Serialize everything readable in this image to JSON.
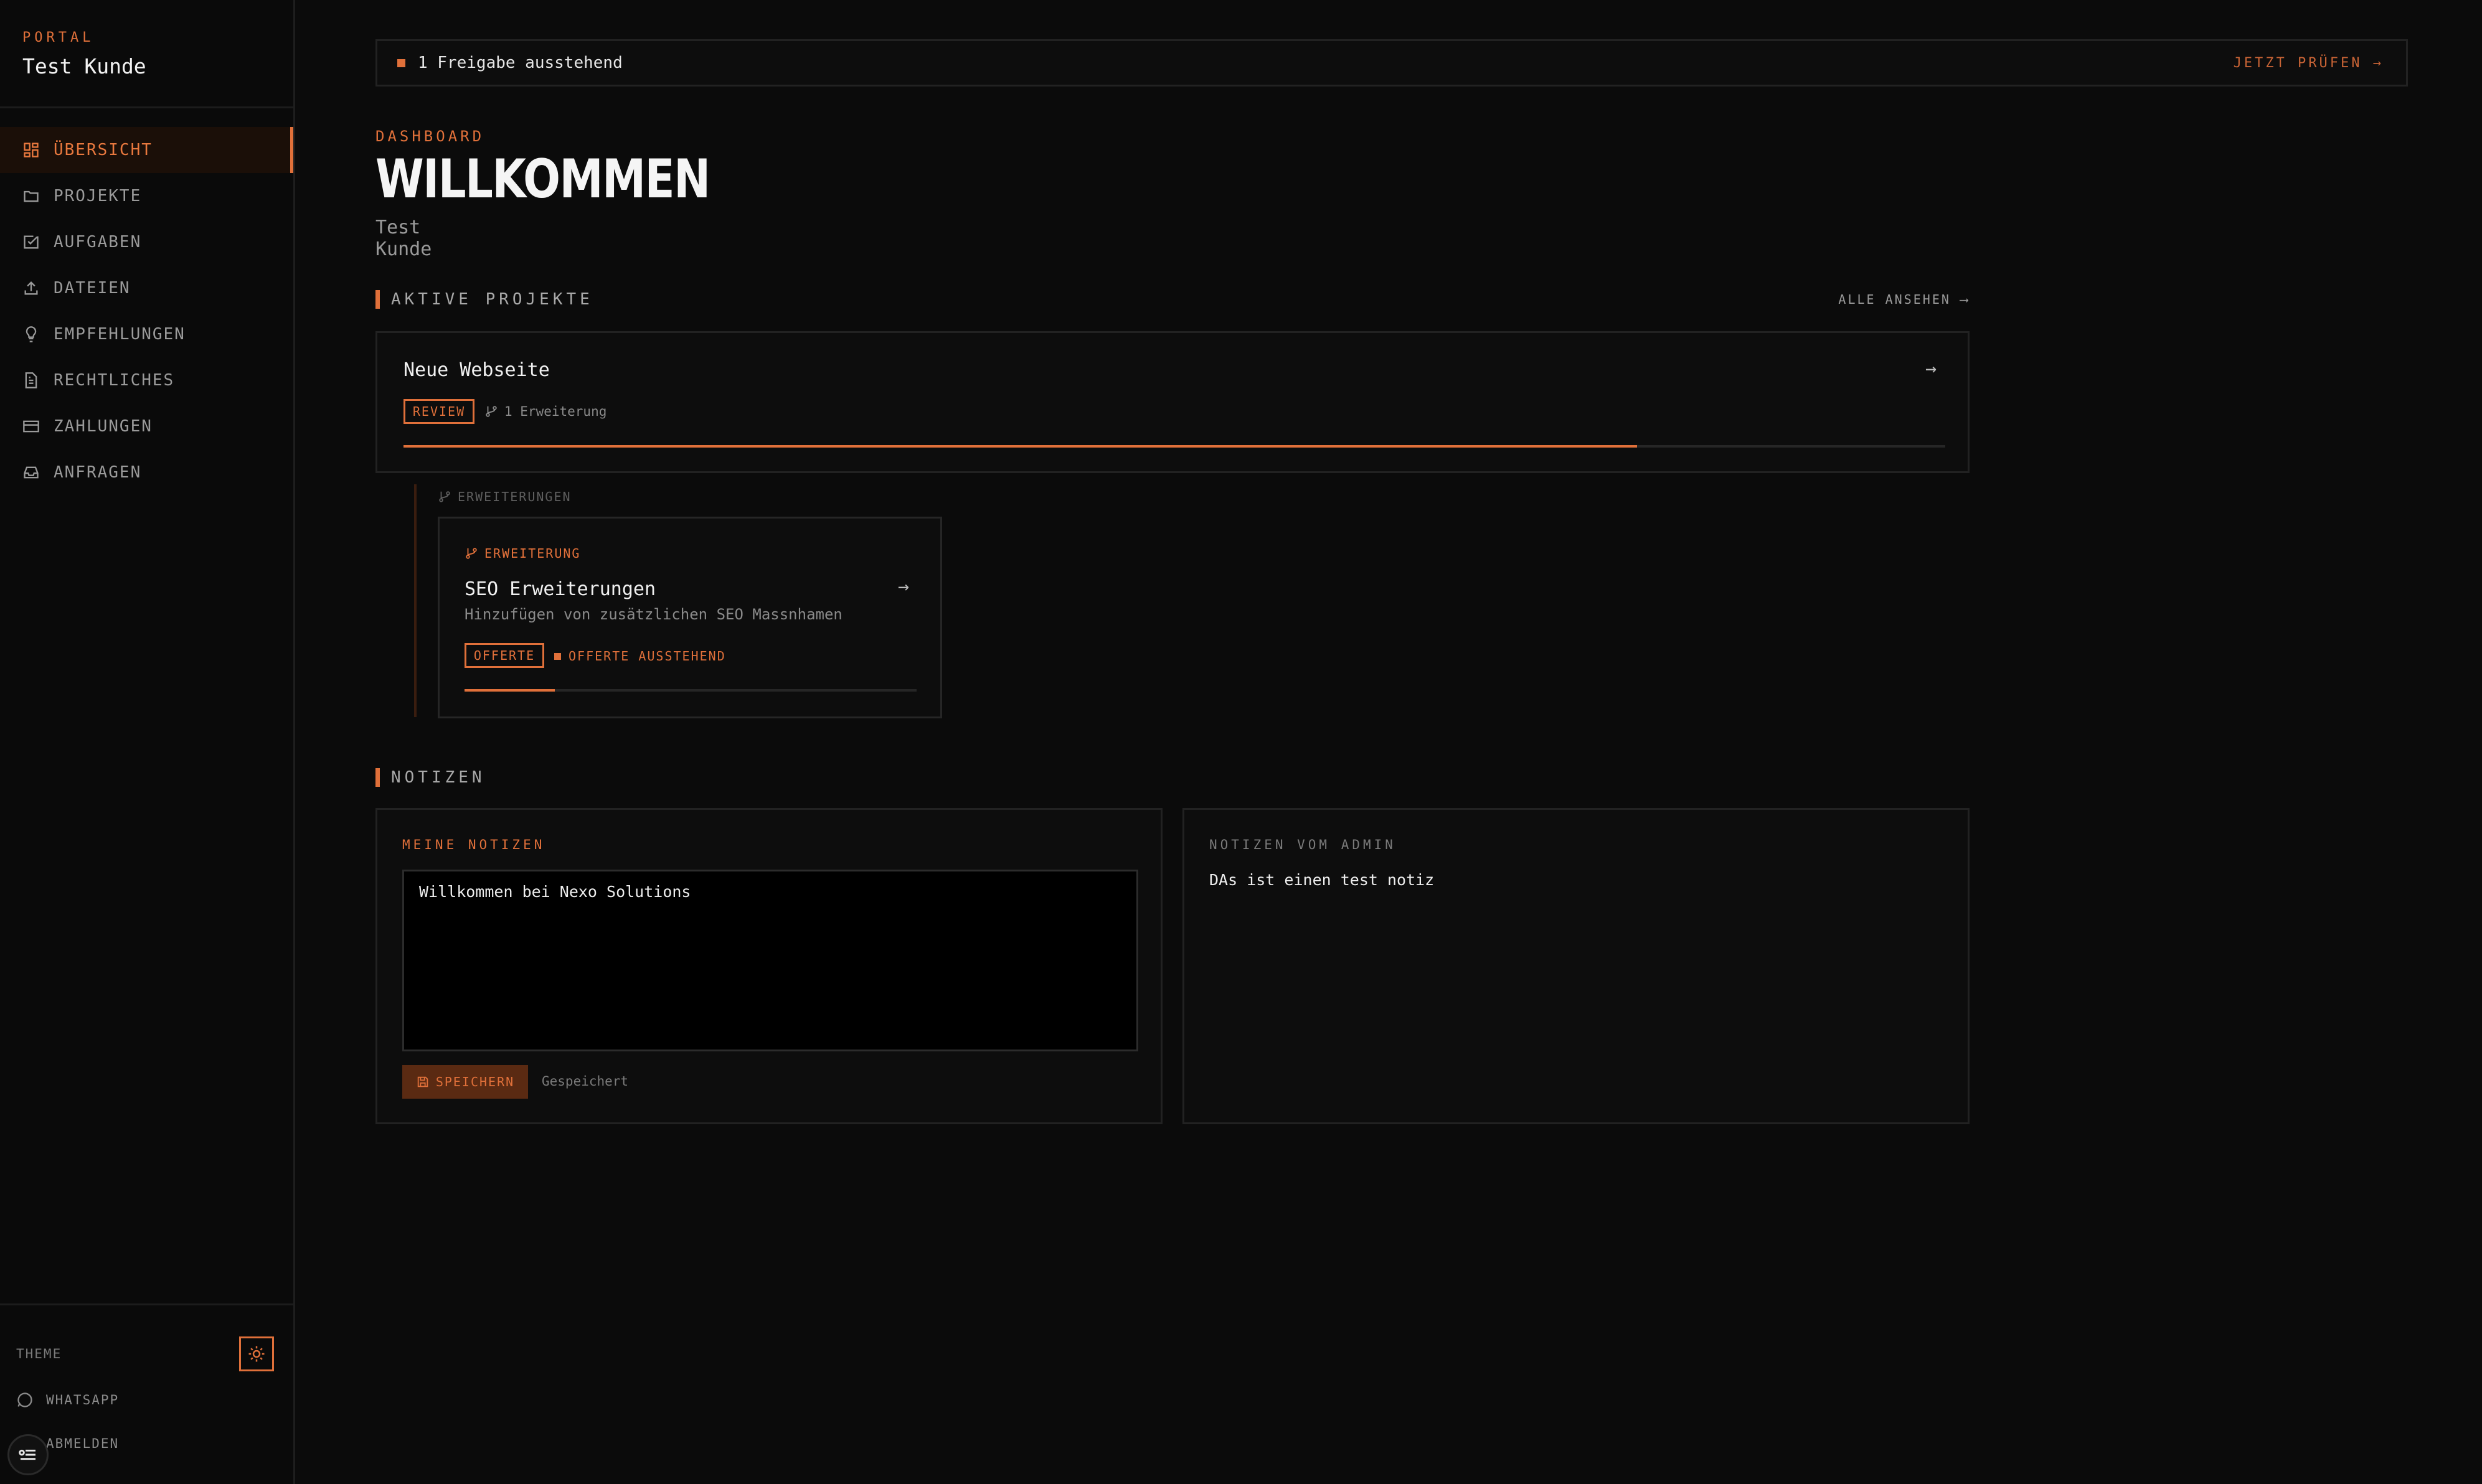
{
  "brand": {
    "kicker": "PORTAL",
    "name": "Test Kunde"
  },
  "nav": [
    {
      "label": "ÜBERSICHT",
      "icon": "dashboard-icon",
      "active": true
    },
    {
      "label": "PROJEKTE",
      "icon": "folder-icon"
    },
    {
      "label": "AUFGABEN",
      "icon": "checkbox-icon"
    },
    {
      "label": "DATEIEN",
      "icon": "upload-icon"
    },
    {
      "label": "EMPFEHLUNGEN",
      "icon": "lightbulb-icon"
    },
    {
      "label": "RECHTLICHES",
      "icon": "document-icon"
    },
    {
      "label": "ZAHLUNGEN",
      "icon": "credit-card-icon"
    },
    {
      "label": "ANFRAGEN",
      "icon": "inbox-icon"
    }
  ],
  "sidebar_bottom": {
    "theme_label": "THEME",
    "whatsapp": "WHATSAPP",
    "logout": "ABMELDEN"
  },
  "alert": {
    "text": "1 Freigabe ausstehend",
    "action": "JETZT PRÜFEN →"
  },
  "header": {
    "kicker": "DASHBOARD",
    "title": "WILLKOMMEN",
    "subtitle": "Test Kunde"
  },
  "projects": {
    "section_title": "AKTIVE PROJEKTE",
    "view_all": "ALLE ANSEHEN ⟶",
    "card": {
      "name": "Neue Webseite",
      "status": "REVIEW",
      "extensions": "1 Erweiterung",
      "progress": 0.8
    },
    "extensions_header": "ERWEITERUNGEN",
    "extension": {
      "kicker": "ERWEITERUNG",
      "title": "SEO Erweiterungen",
      "description": "Hinzufügen von zusätzlichen SEO Massnhamen",
      "status": "OFFERTE",
      "pending": "OFFERTE AUSSTEHEND",
      "progress": 0.2
    }
  },
  "notes": {
    "section_title": "NOTIZEN",
    "mine": {
      "kicker": "MEINE NOTIZEN",
      "value": "Willkommen bei Nexo Solutions",
      "save_label": "SPEICHERN",
      "saved": "Gespeichert"
    },
    "admin": {
      "kicker": "NOTIZEN VOM ADMIN",
      "text": "DAs ist einen test notiz"
    }
  },
  "colors": {
    "accent": "#e0703a",
    "background": "#0b0b0b",
    "card": "#0d0d0d"
  }
}
